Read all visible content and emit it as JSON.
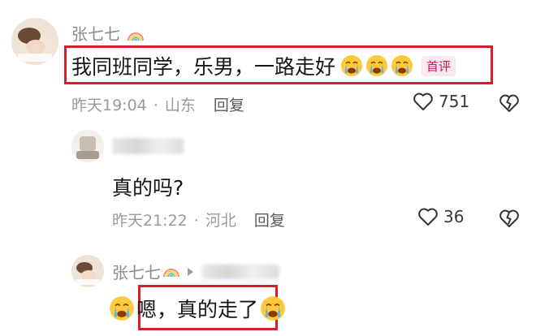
{
  "comments": [
    {
      "author": "张七七",
      "text": "我同班同学，乐男，一路走好",
      "badge": "首评",
      "time": "昨天19:04",
      "location": "山东",
      "reply_label": "回复",
      "likes": "751"
    },
    {
      "text": "真的吗?",
      "time": "昨天21:22",
      "location": "河北",
      "reply_label": "回复",
      "likes": "36"
    },
    {
      "author": "张七七",
      "text": "嗯，真的走了"
    }
  ],
  "separator": "·",
  "colors": {
    "highlight": "#d61f2b",
    "badge": "#c2185b",
    "meta": "#9a9a9a"
  },
  "icons": [
    "rainbow-badge-icon",
    "crying-emoji-icon",
    "heart-icon",
    "broken-heart-icon",
    "reply-arrow-icon"
  ]
}
